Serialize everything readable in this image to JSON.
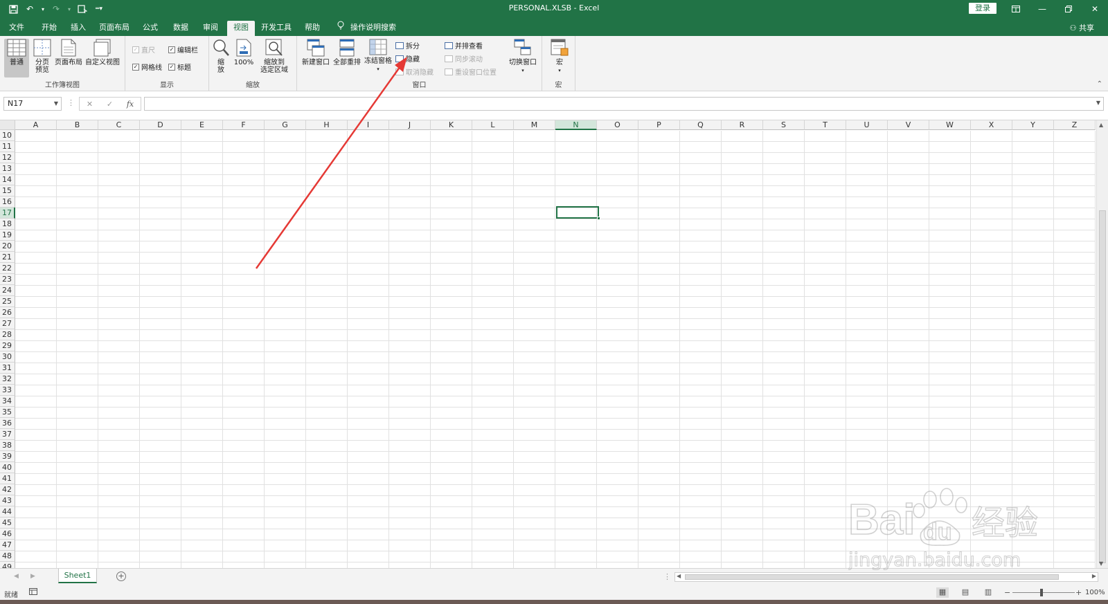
{
  "window": {
    "title": "PERSONAL.XLSB  -  Excel",
    "login_label": "登录",
    "share_label": "共享"
  },
  "tabs": [
    {
      "label": "文件",
      "active": false
    },
    {
      "label": "开始",
      "active": false
    },
    {
      "label": "插入",
      "active": false
    },
    {
      "label": "页面布局",
      "active": false
    },
    {
      "label": "公式",
      "active": false
    },
    {
      "label": "数据",
      "active": false
    },
    {
      "label": "审阅",
      "active": false
    },
    {
      "label": "视图",
      "active": true
    },
    {
      "label": "开发工具",
      "active": false
    },
    {
      "label": "帮助",
      "active": false
    },
    {
      "label": "操作说明搜索",
      "active": false
    }
  ],
  "ribbon": {
    "workbook_views": {
      "label": "工作簿视图",
      "normal": "普通",
      "page_break_l1": "分页",
      "page_break_l2": "预览",
      "page_layout": "页面布局",
      "custom_views": "自定义视图"
    },
    "show": {
      "label": "显示",
      "ruler": "直尺",
      "formula_bar": "编辑栏",
      "gridlines": "网格线",
      "headings": "标题"
    },
    "zoom": {
      "label": "缩放",
      "zoom_l1": "缩",
      "zoom_l2": "放",
      "hundred": "100%",
      "to_selection_l1": "缩放到",
      "to_selection_l2": "选定区域"
    },
    "window": {
      "label": "窗口",
      "new_window": "新建窗口",
      "arrange_all": "全部重排",
      "freeze_panes": "冻结窗格",
      "split": "拆分",
      "hide": "隐藏",
      "unhide": "取消隐藏",
      "side_by_side": "并排查看",
      "sync_scroll": "同步滚动",
      "reset_position": "重设窗口位置",
      "switch_windows": "切换窗口"
    },
    "macros": {
      "label": "宏",
      "macros": "宏"
    }
  },
  "formula_bar": {
    "name_box": "N17",
    "fx": "fx"
  },
  "grid": {
    "columns": [
      "A",
      "B",
      "C",
      "D",
      "E",
      "F",
      "G",
      "H",
      "I",
      "J",
      "K",
      "L",
      "M",
      "N",
      "O",
      "P",
      "Q",
      "R",
      "S",
      "T",
      "U",
      "V",
      "W",
      "X",
      "Y",
      "Z"
    ],
    "rows": [
      "10",
      "11",
      "12",
      "13",
      "14",
      "15",
      "16",
      "17",
      "18",
      "19",
      "20",
      "21",
      "22",
      "23",
      "24",
      "25",
      "26",
      "27",
      "28",
      "29",
      "30",
      "31",
      "32",
      "33",
      "34",
      "35",
      "36",
      "37",
      "38",
      "39",
      "40",
      "41",
      "42",
      "43",
      "44",
      "45",
      "46",
      "47",
      "48",
      "49"
    ],
    "selected_col": "N",
    "selected_row": "17"
  },
  "sheets": {
    "tabs": [
      "Sheet1"
    ],
    "add": "+"
  },
  "status": {
    "ready": "就绪",
    "zoom": "100%"
  },
  "watermark": {
    "brand": "Bai",
    "brand2": "du",
    "cn": "经验",
    "url": "jingyan.baidu.com"
  }
}
